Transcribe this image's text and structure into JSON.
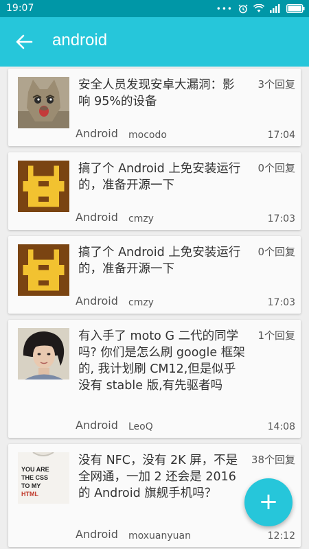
{
  "status_bar": {
    "time": "19:07",
    "icons": [
      "dots-icon",
      "alarm-icon",
      "wifi-icon",
      "signal-icon",
      "battery-icon"
    ]
  },
  "app_bar": {
    "title": "android",
    "back_icon": "arrow-back-icon"
  },
  "topics": [
    {
      "title": "安全人员发现安卓大漏洞：影响 95%的设备",
      "replies": "3个回复",
      "node": "Android",
      "author": "mocodo",
      "time": "17:04",
      "avatar": "cat-photo"
    },
    {
      "title": "搞了个 Android 上免安装运行的，准备开源一下",
      "replies": "0个回复",
      "node": "Android",
      "author": "cmzy",
      "time": "17:03",
      "avatar": "pixel-identicon"
    },
    {
      "title": "搞了个 Android 上免安装运行的，准备开源一下",
      "replies": "0个回复",
      "node": "Android",
      "author": "cmzy",
      "time": "17:03",
      "avatar": "pixel-identicon"
    },
    {
      "title": "有入手了 moto G 二代的同学吗? 你们是怎么刷 google 框架的, 我计划刷 CM12,但是似乎没有 stable 版,有先驱者吗",
      "replies": "1个回复",
      "node": "Android",
      "author": "LeoQ",
      "time": "14:08",
      "avatar": "person-photo"
    },
    {
      "title": "没有 NFC，没有 2K 屏，不是全网通，一加 2 还会是 2016 的 Android 旗舰手机吗？",
      "replies": "38个回复",
      "node": "Android",
      "author": "moxuanyuan",
      "time": "12:12",
      "avatar": "tshirt-photo",
      "avatar_text": [
        "YOU ARE",
        "THE CSS",
        "TO MY",
        "HTML"
      ]
    }
  ],
  "fab": {
    "label": "+",
    "icon": "add-icon"
  },
  "colors": {
    "status_bar": "#0097a7",
    "app_bar": "#26c6da",
    "accent": "#26c6da",
    "identicon_bg": "#7a4412",
    "identicon_fg": "#f2c230"
  }
}
